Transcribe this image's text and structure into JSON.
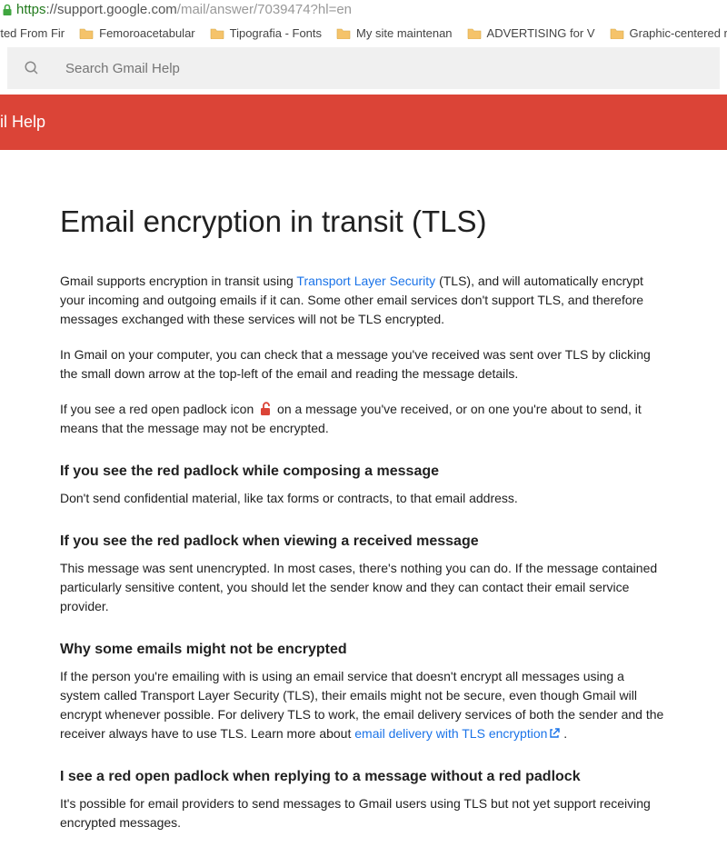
{
  "browser": {
    "url_secure_part": "https",
    "url_host_part": "://support.google.com",
    "url_path_part": "/mail/answer/7039474?hl=en"
  },
  "bookmarks": {
    "item0": "rted From Fir",
    "item1": "Femoroacetabular",
    "item2": "Tipografia - Fonts",
    "item3": "My site maintenan",
    "item4": "ADVERTISING for V",
    "item5": "Graphic-centered r"
  },
  "search": {
    "placeholder": "Search Gmail Help"
  },
  "banner": {
    "title": "il Help"
  },
  "article": {
    "title": "Email encryption in transit (TLS)",
    "p1_a": "Gmail supports encryption in transit using ",
    "p1_link": "Transport Layer Security",
    "p1_b": " (TLS), and will automatically encrypt your incoming and outgoing emails if it can. Some other email services don't support TLS, and therefore messages exchanged with these services will not be TLS encrypted.",
    "p2": "In Gmail on your computer, you can check that a message you've received was sent over TLS by clicking the small down arrow at the top-left of the email and reading the message details.",
    "p3_a": "If you see a red open padlock icon ",
    "p3_b": " on a message you've received, or on one you're about to send, it means that the message may not be encrypted.",
    "h2_1": "If you see the red padlock while composing a message",
    "p4": "Don't send confidential material, like tax forms or contracts, to that email address.",
    "h2_2": "If you see the red padlock when viewing a received message",
    "p5": "This message was sent unencrypted. In most cases, there's nothing you can do. If the message contained particularly sensitive content, you should let the sender know and they can contact their email service provider.",
    "h2_3": "Why some emails might not be encrypted",
    "p6_a": "If the person you're emailing with is using an email service that doesn't encrypt all messages using a system called Transport Layer Security (TLS), their emails might not be secure, even though Gmail will encrypt whenever possible. For delivery TLS to work, the email delivery services of both the sender and the receiver always have to use TLS. Learn more about ",
    "p6_link": "email delivery with TLS encryption",
    "p6_b": " .",
    "h2_4": "I see a red open padlock when replying to a message without a red padlock",
    "p7": "It's possible for email providers to send messages to Gmail users using TLS but not yet support receiving encrypted messages."
  }
}
